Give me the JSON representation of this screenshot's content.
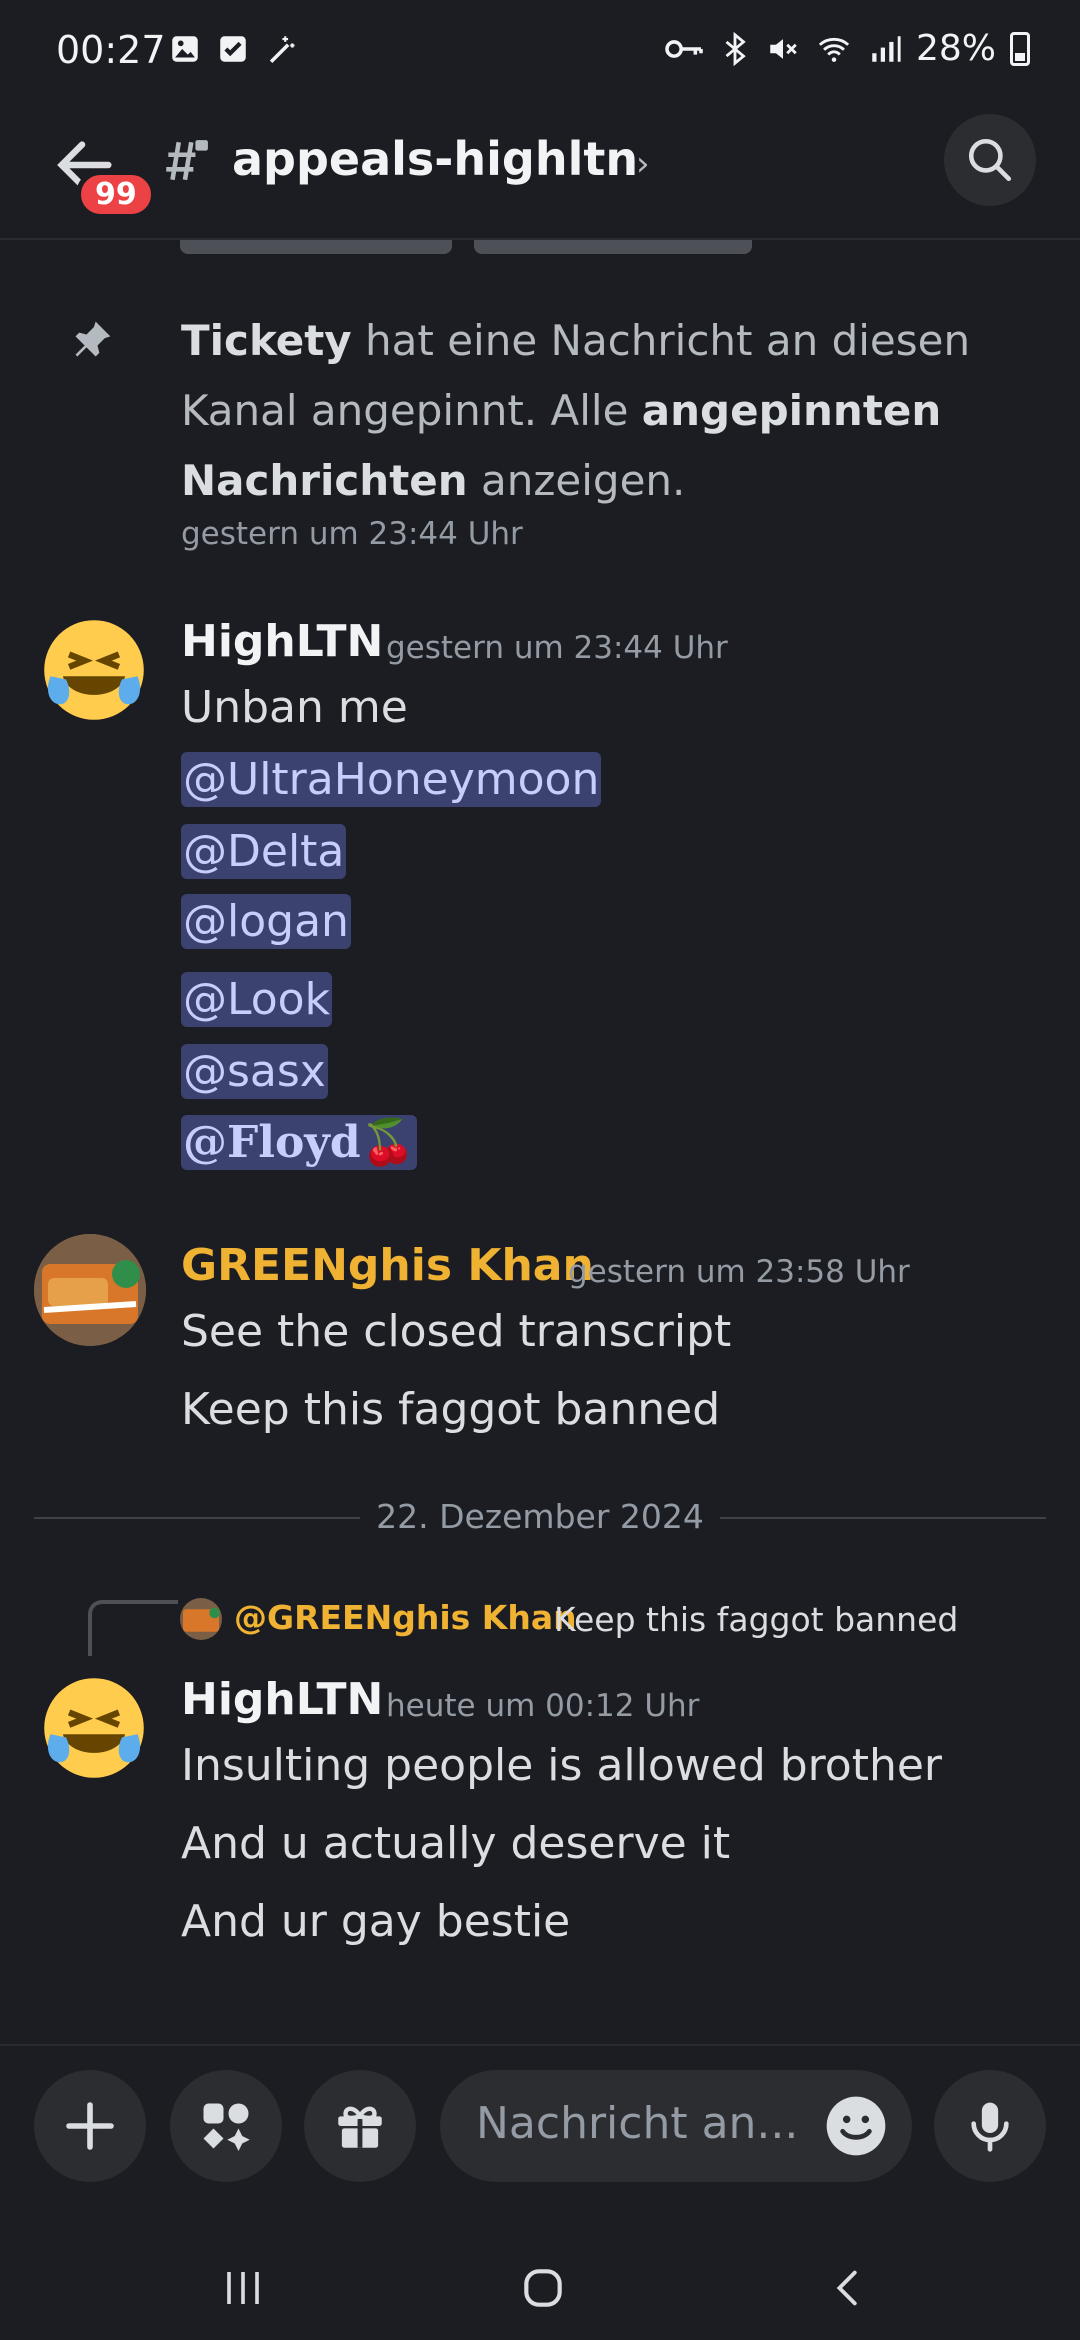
{
  "status_bar": {
    "time": "00:27",
    "battery": "28%"
  },
  "header": {
    "unread_badge": "99",
    "channel_name": "appeals-highltn",
    "chevron": "›"
  },
  "system_message": {
    "actor": "Tickety",
    "text_part1": " hat eine Nachricht an diesen Kanal angepinnt. Alle ",
    "link_text": "angepinnten Nachrichten",
    "text_part2": " anzeigen.",
    "timestamp": "gestern um 23:44 Uhr"
  },
  "messages": [
    {
      "author": "HighLTN",
      "timestamp": "gestern um 23:44 Uhr",
      "lines": [
        "Unban me"
      ],
      "mentions": [
        "@UltraHoneymoon",
        "@Delta",
        "@logan",
        "@Look",
        "@sasx",
        "@Floyd🍒"
      ]
    },
    {
      "author": "GREENghis Khan",
      "timestamp": "gestern um 23:58 Uhr",
      "lines": [
        "See the closed transcript",
        "Keep this faggot banned"
      ]
    },
    {
      "author": "HighLTN",
      "timestamp": "heute um 00:12 Uhr",
      "reply_to": {
        "author": "@GREENghis Khan",
        "text": "Keep this faggot banned"
      },
      "lines": [
        "Insulting people is allowed brother",
        "And u actually deserve it",
        "And ur gay bestie"
      ]
    }
  ],
  "date_divider": "22. Dezember 2024",
  "composer": {
    "placeholder": "Nachricht an..."
  },
  "colors": {
    "background": "#1c1d22",
    "mention_bg": "#3c4270",
    "username_gold": "#f0b232",
    "badge_red": "#ed4245"
  }
}
